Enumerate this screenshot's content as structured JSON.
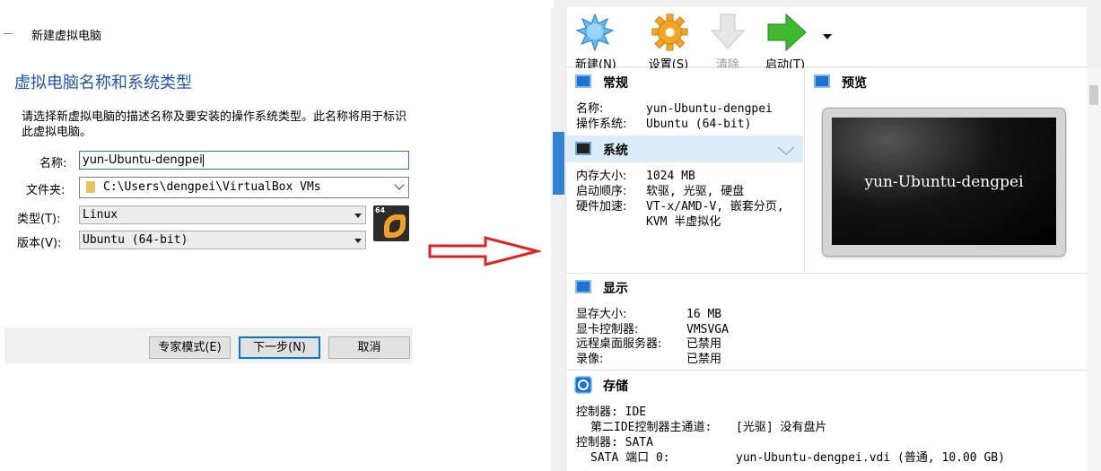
{
  "dialog": {
    "title": "新建虚拟电脑",
    "heading": "虚拟电脑名称和系统类型",
    "description": "请选择新虚拟电脑的描述名称及要安装的操作系统类型。此名称将用于标识此虚拟电脑。",
    "name_label": "名称:",
    "name_value": "yun-Ubuntu-dengpei",
    "folder_label": "文件夹:",
    "folder_value": "C:\\Users\\dengpei\\VirtualBox VMs",
    "type_label": "类型(T):",
    "type_value": "Linux",
    "version_label": "版本(V):",
    "version_value": "Ubuntu (64-bit)",
    "os_badge": "64",
    "buttons": {
      "expert": "专家模式(E)",
      "next": "下一步(N)",
      "cancel": "取消"
    }
  },
  "manager": {
    "toolbar": {
      "new": "新建(N)",
      "settings": "设置(S)",
      "discard": "清除",
      "start": "启动(T)"
    },
    "general": {
      "title": "常规",
      "name_label": "名称:",
      "name_value": "yun-Ubuntu-dengpei",
      "os_label": "操作系统:",
      "os_value": "Ubuntu (64-bit)"
    },
    "system": {
      "title": "系统",
      "memory_label": "内存大小:",
      "memory_value": "1024 MB",
      "boot_label": "启动顺序:",
      "boot_value": "软驱, 光驱, 硬盘",
      "accel_label": "硬件加速:",
      "accel_value_line1": "VT-x/AMD-V, 嵌套分页,",
      "accel_value_line2": "KVM 半虚拟化"
    },
    "preview": {
      "title": "预览",
      "screen_text": "yun-Ubuntu-dengpei"
    },
    "display": {
      "title": "显示",
      "vram_label": "显存大小:",
      "vram_value": "16 MB",
      "controller_label": "显卡控制器:",
      "controller_value": "VMSVGA",
      "rdp_label": "远程桌面服务器:",
      "rdp_value": "已禁用",
      "recording_label": "录像:",
      "recording_value": "已禁用"
    },
    "storage": {
      "title": "存储",
      "ctrl_ide": "控制器: IDE",
      "ide_port": "第二IDE控制器主通道:",
      "ide_value": "[光驱] 没有盘片",
      "ctrl_sata": "控制器: SATA",
      "sata_port": "SATA 端口 0:",
      "sata_value": "yun-Ubuntu-dengpei.vdi (普通, 10.00 GB)"
    }
  },
  "colors": {
    "heading_blue": "#1f55b0",
    "arrow_red": "#e02020",
    "selection_blue": "#dcecfb"
  }
}
